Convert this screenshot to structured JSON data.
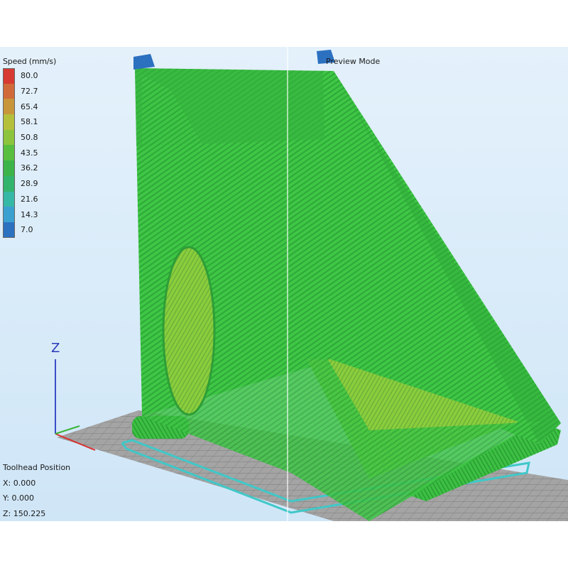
{
  "legend": {
    "title": "Speed (mm/s)",
    "items": [
      {
        "value": "80.0",
        "color": "#d63a32"
      },
      {
        "value": "72.7",
        "color": "#d06a3a"
      },
      {
        "value": "65.4",
        "color": "#c8963a"
      },
      {
        "value": "58.1",
        "color": "#b4c03c"
      },
      {
        "value": "50.8",
        "color": "#8cc43e"
      },
      {
        "value": "43.5",
        "color": "#58be40"
      },
      {
        "value": "36.2",
        "color": "#3cb44a"
      },
      {
        "value": "28.9",
        "color": "#32b46c"
      },
      {
        "value": "21.6",
        "color": "#36b8a6"
      },
      {
        "value": "14.3",
        "color": "#3aa0d0"
      },
      {
        "value": "7.0",
        "color": "#2c70c0"
      }
    ]
  },
  "mode_label": "Preview Mode",
  "axis": {
    "z_label": "Z"
  },
  "toolhead": {
    "title": "Toolhead Position",
    "x": "X: 0.000",
    "y": "Y: 0.000",
    "z": "Z: 150.225"
  },
  "colors": {
    "model_green": "#3cc640",
    "model_light": "#86cf3c",
    "bed_grid": "#9a9a9a",
    "travel_cyan": "#40c8c8"
  }
}
